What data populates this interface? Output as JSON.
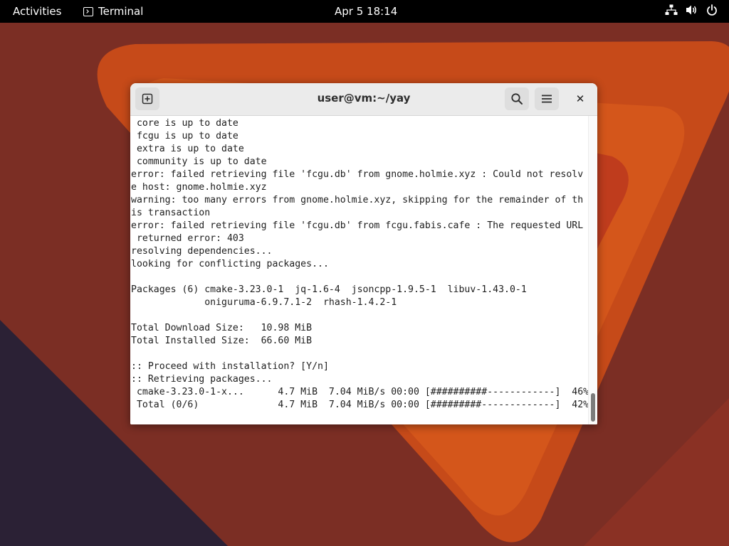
{
  "topbar": {
    "activities_label": "Activities",
    "app_name": "Terminal",
    "clock": "Apr 5  18:14",
    "icons": [
      "network-icon",
      "volume-icon",
      "power-icon"
    ]
  },
  "window": {
    "title": "user@vm:~/yay",
    "buttons": [
      "new-tab-icon",
      "search-icon",
      "hamburger-menu-icon",
      "close-icon"
    ],
    "close_glyph": "✕"
  },
  "terminal": {
    "lines": [
      " core is up to date",
      " fcgu is up to date",
      " extra is up to date",
      " community is up to date",
      "error: failed retrieving file 'fcgu.db' from gnome.holmie.xyz : Could not resolv",
      "e host: gnome.holmie.xyz",
      "warning: too many errors from gnome.holmie.xyz, skipping for the remainder of th",
      "is transaction",
      "error: failed retrieving file 'fcgu.db' from fcgu.fabis.cafe : The requested URL",
      " returned error: 403",
      "resolving dependencies...",
      "looking for conflicting packages...",
      "",
      "Packages (6) cmake-3.23.0-1  jq-1.6-4  jsoncpp-1.9.5-1  libuv-1.43.0-1",
      "             oniguruma-6.9.7.1-2  rhash-1.4.2-1",
      "",
      "Total Download Size:   10.98 MiB",
      "Total Installed Size:  66.60 MiB",
      "",
      ":: Proceed with installation? [Y/n]",
      ":: Retrieving packages...",
      " cmake-3.23.0-1-x...      4.7 MiB  7.04 MiB/s 00:00 [##########------------]  46%",
      " Total (0/6)              4.7 MiB  7.04 MiB/s 00:00 [#########-------------]  42%"
    ]
  },
  "colors": {
    "topbar_bg": "#000000",
    "headerbar_bg": "#ebebeb",
    "terminal_bg": "#ffffff",
    "terminal_fg": "#1e1e1e",
    "wallpaper_dark": "#2a2030",
    "wallpaper_red": "#7a2e22",
    "wallpaper_orange": "#c9491a"
  }
}
